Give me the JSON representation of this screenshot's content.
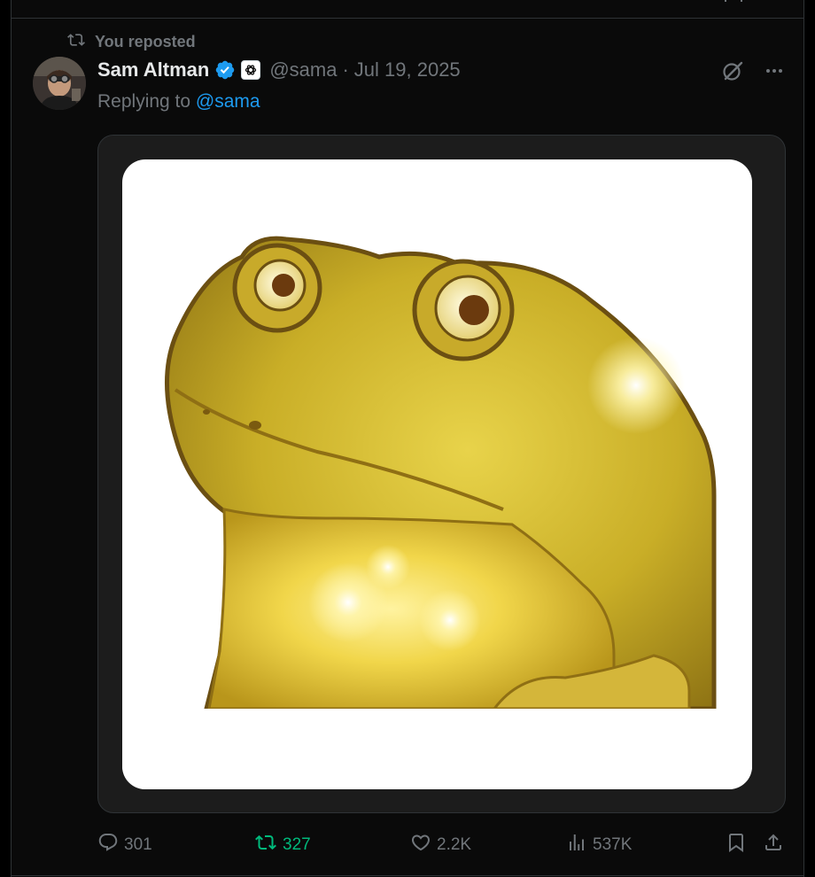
{
  "repost": {
    "label": "You reposted",
    "icon": "repost-icon"
  },
  "post": {
    "author_name": "Sam Altman",
    "author_handle": "@sama",
    "separator": "·",
    "date": "Jul 19, 2025",
    "replying_prefix": "Replying to",
    "replying_handle": "@sama",
    "verified_icon": "verified-badge-icon",
    "affiliate_icon": "openai-logo-icon",
    "media": {
      "description_icon": "golden-frog-image"
    }
  },
  "actions": {
    "replies": "301",
    "reposts": "327",
    "likes": "2.2K",
    "views": "537K"
  },
  "colors": {
    "background": "#0a0a0a",
    "text_primary": "#e7e9ea",
    "text_secondary": "#71767b",
    "link": "#1d9bf0",
    "repost_active": "#00ba7c",
    "media_card": "#1c1c1c"
  }
}
